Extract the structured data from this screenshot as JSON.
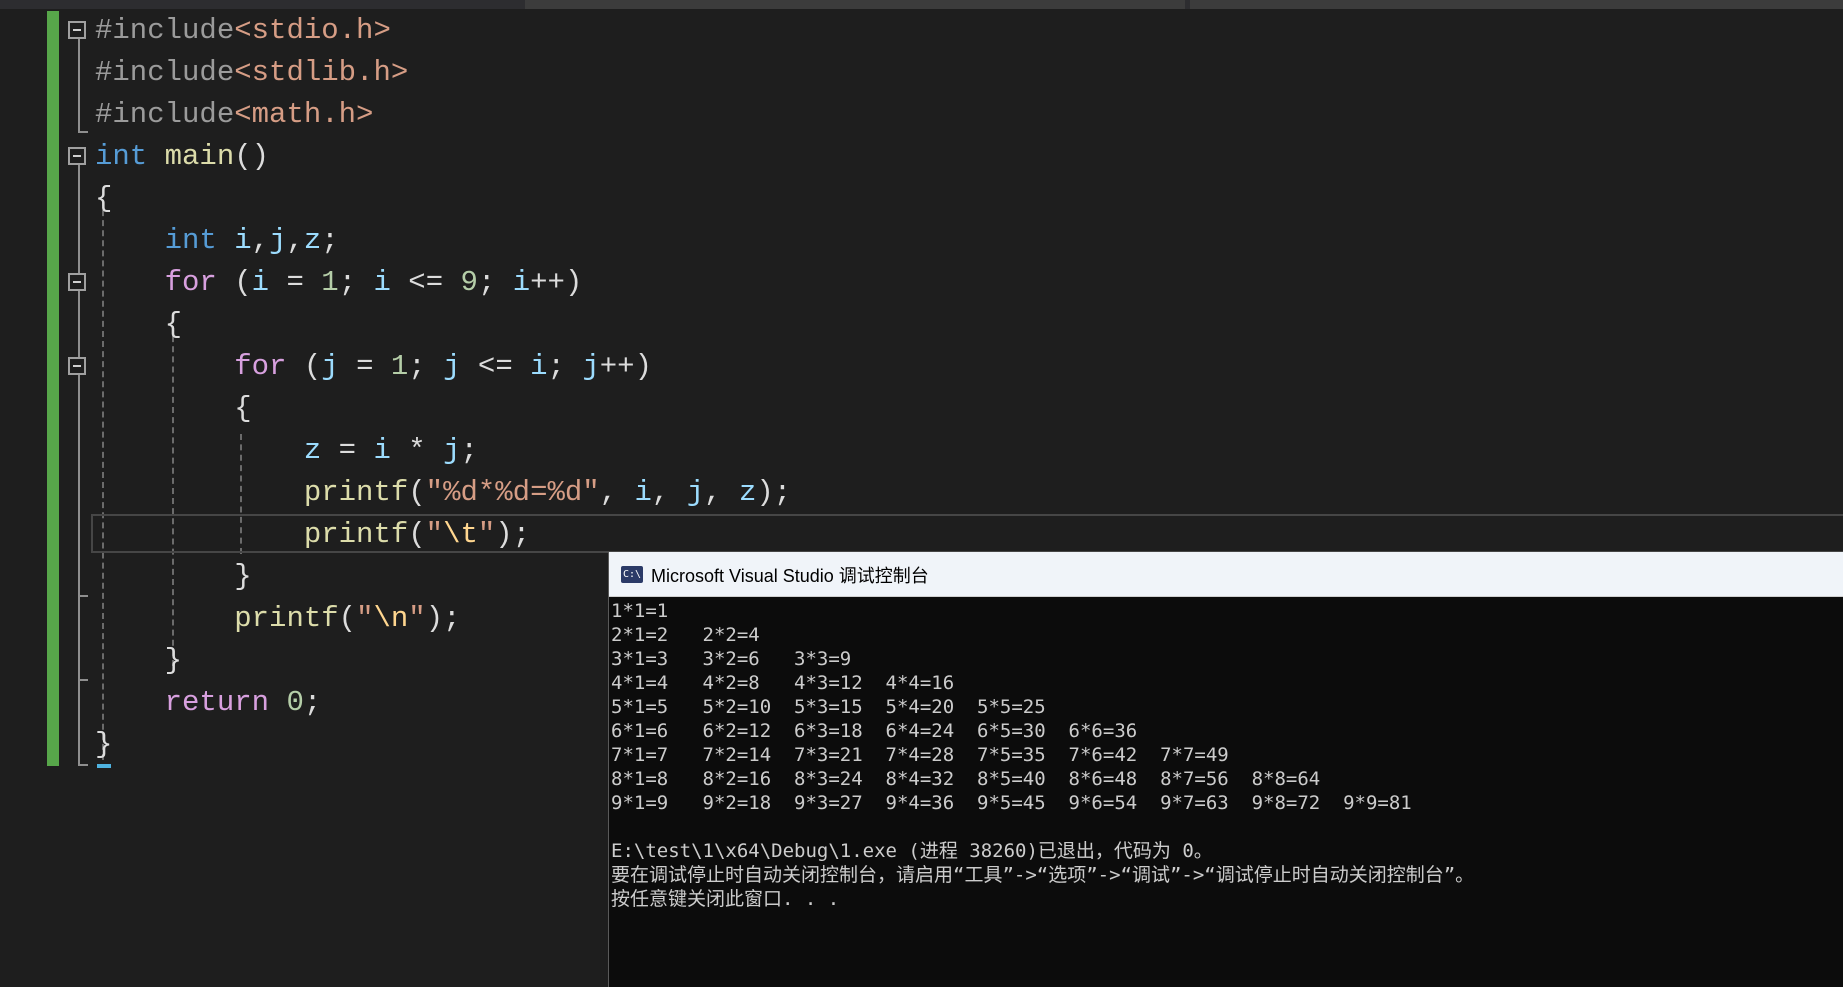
{
  "editor": {
    "lines": [
      [
        [
          "#include",
          "inc"
        ],
        [
          "<stdio.h>",
          "hdr"
        ]
      ],
      [
        [
          "#include",
          "inc"
        ],
        [
          "<stdlib.h>",
          "hdr"
        ]
      ],
      [
        [
          "#include",
          "inc"
        ],
        [
          "<math.h>",
          "hdr"
        ]
      ],
      [
        [
          "int",
          "kw"
        ],
        [
          " ",
          ""
        ],
        [
          "main",
          "fn"
        ],
        [
          "()",
          ""
        ]
      ],
      [
        [
          "{",
          ""
        ]
      ],
      [
        [
          "    ",
          ""
        ],
        [
          "int",
          "kw"
        ],
        [
          " ",
          ""
        ],
        [
          "i",
          "var"
        ],
        [
          ",",
          ""
        ],
        [
          "j",
          "var"
        ],
        [
          ",",
          ""
        ],
        [
          "z",
          "var"
        ],
        [
          ";",
          ""
        ]
      ],
      [
        [
          "    ",
          ""
        ],
        [
          "for",
          "ctl"
        ],
        [
          " (",
          ""
        ],
        [
          "i",
          "var"
        ],
        [
          " = ",
          ""
        ],
        [
          "1",
          "num"
        ],
        [
          "; ",
          ""
        ],
        [
          "i",
          "var"
        ],
        [
          " <= ",
          ""
        ],
        [
          "9",
          "num"
        ],
        [
          "; ",
          ""
        ],
        [
          "i",
          "var"
        ],
        [
          "++)",
          ""
        ]
      ],
      [
        [
          "    ",
          ""
        ],
        [
          "{",
          ""
        ]
      ],
      [
        [
          "        ",
          ""
        ],
        [
          "for",
          "ctl"
        ],
        [
          " (",
          ""
        ],
        [
          "j",
          "var"
        ],
        [
          " = ",
          ""
        ],
        [
          "1",
          "num"
        ],
        [
          "; ",
          ""
        ],
        [
          "j",
          "var"
        ],
        [
          " <= ",
          ""
        ],
        [
          "i",
          "var"
        ],
        [
          "; ",
          ""
        ],
        [
          "j",
          "var"
        ],
        [
          "++)",
          ""
        ]
      ],
      [
        [
          "        ",
          ""
        ],
        [
          "{",
          ""
        ]
      ],
      [
        [
          "            ",
          ""
        ],
        [
          "z",
          "var"
        ],
        [
          " = ",
          ""
        ],
        [
          "i",
          "var"
        ],
        [
          " * ",
          ""
        ],
        [
          "j",
          "var"
        ],
        [
          ";",
          ""
        ]
      ],
      [
        [
          "            ",
          ""
        ],
        [
          "printf",
          "fn"
        ],
        [
          "(",
          ""
        ],
        [
          "\"%d*%d=%d\"",
          "str"
        ],
        [
          ", ",
          ""
        ],
        [
          "i",
          "var"
        ],
        [
          ", ",
          ""
        ],
        [
          "j",
          "var"
        ],
        [
          ", ",
          ""
        ],
        [
          "z",
          "var"
        ],
        [
          ");",
          ""
        ]
      ],
      [
        [
          "            ",
          ""
        ],
        [
          "printf",
          "fn"
        ],
        [
          "(",
          ""
        ],
        [
          "\"",
          "str"
        ],
        [
          "\\t",
          "esc"
        ],
        [
          "\"",
          "str"
        ],
        [
          ");",
          ""
        ]
      ],
      [
        [
          "        ",
          ""
        ],
        [
          "}",
          ""
        ]
      ],
      [
        [
          "        ",
          ""
        ],
        [
          "printf",
          "fn"
        ],
        [
          "(",
          ""
        ],
        [
          "\"",
          "str"
        ],
        [
          "\\n",
          "esc"
        ],
        [
          "\"",
          "str"
        ],
        [
          ");",
          ""
        ]
      ],
      [
        [
          "    ",
          ""
        ],
        [
          "}",
          ""
        ]
      ],
      [
        [
          "    ",
          ""
        ],
        [
          "return",
          "ctl"
        ],
        [
          " ",
          ""
        ],
        [
          "0",
          "num"
        ],
        [
          ";",
          ""
        ]
      ],
      [
        [
          "}",
          ""
        ]
      ]
    ]
  },
  "console": {
    "title": "Microsoft Visual Studio 调试控制台",
    "icon": "console-app-icon",
    "icon_glyph": "C:\\",
    "lines": [
      "1*1=1",
      "2*1=2   2*2=4",
      "3*1=3   3*2=6   3*3=9",
      "4*1=4   4*2=8   4*3=12  4*4=16",
      "5*1=5   5*2=10  5*3=15  5*4=20  5*5=25",
      "6*1=6   6*2=12  6*3=18  6*4=24  6*5=30  6*6=36",
      "7*1=7   7*2=14  7*3=21  7*4=28  7*5=35  7*6=42  7*7=49",
      "8*1=8   8*2=16  8*3=24  8*4=32  8*5=40  8*6=48  8*7=56  8*8=64",
      "9*1=9   9*2=18  9*3=27  9*4=36  9*5=45  9*6=54  9*7=63  9*8=72  9*9=81",
      "",
      "E:\\test\\1\\x64\\Debug\\1.exe (进程 38260)已退出，代码为 0。",
      "要在调试停止时自动关闭控制台，请启用“工具”->“选项”->“调试”->“调试停止时自动关闭控制台”。",
      "按任意键关闭此窗口. . ."
    ]
  },
  "colors": {
    "editor_bg": "#1e1e1e",
    "change_bar": "#57a64a",
    "keyword": "#569cd6",
    "control": "#d8a0df",
    "function": "#dcdcaa",
    "string": "#d69d85",
    "number": "#b5cea8",
    "variable": "#9cdcfe",
    "console_bg": "#0c0c0c",
    "console_title_bg": "#f0f4f9"
  }
}
